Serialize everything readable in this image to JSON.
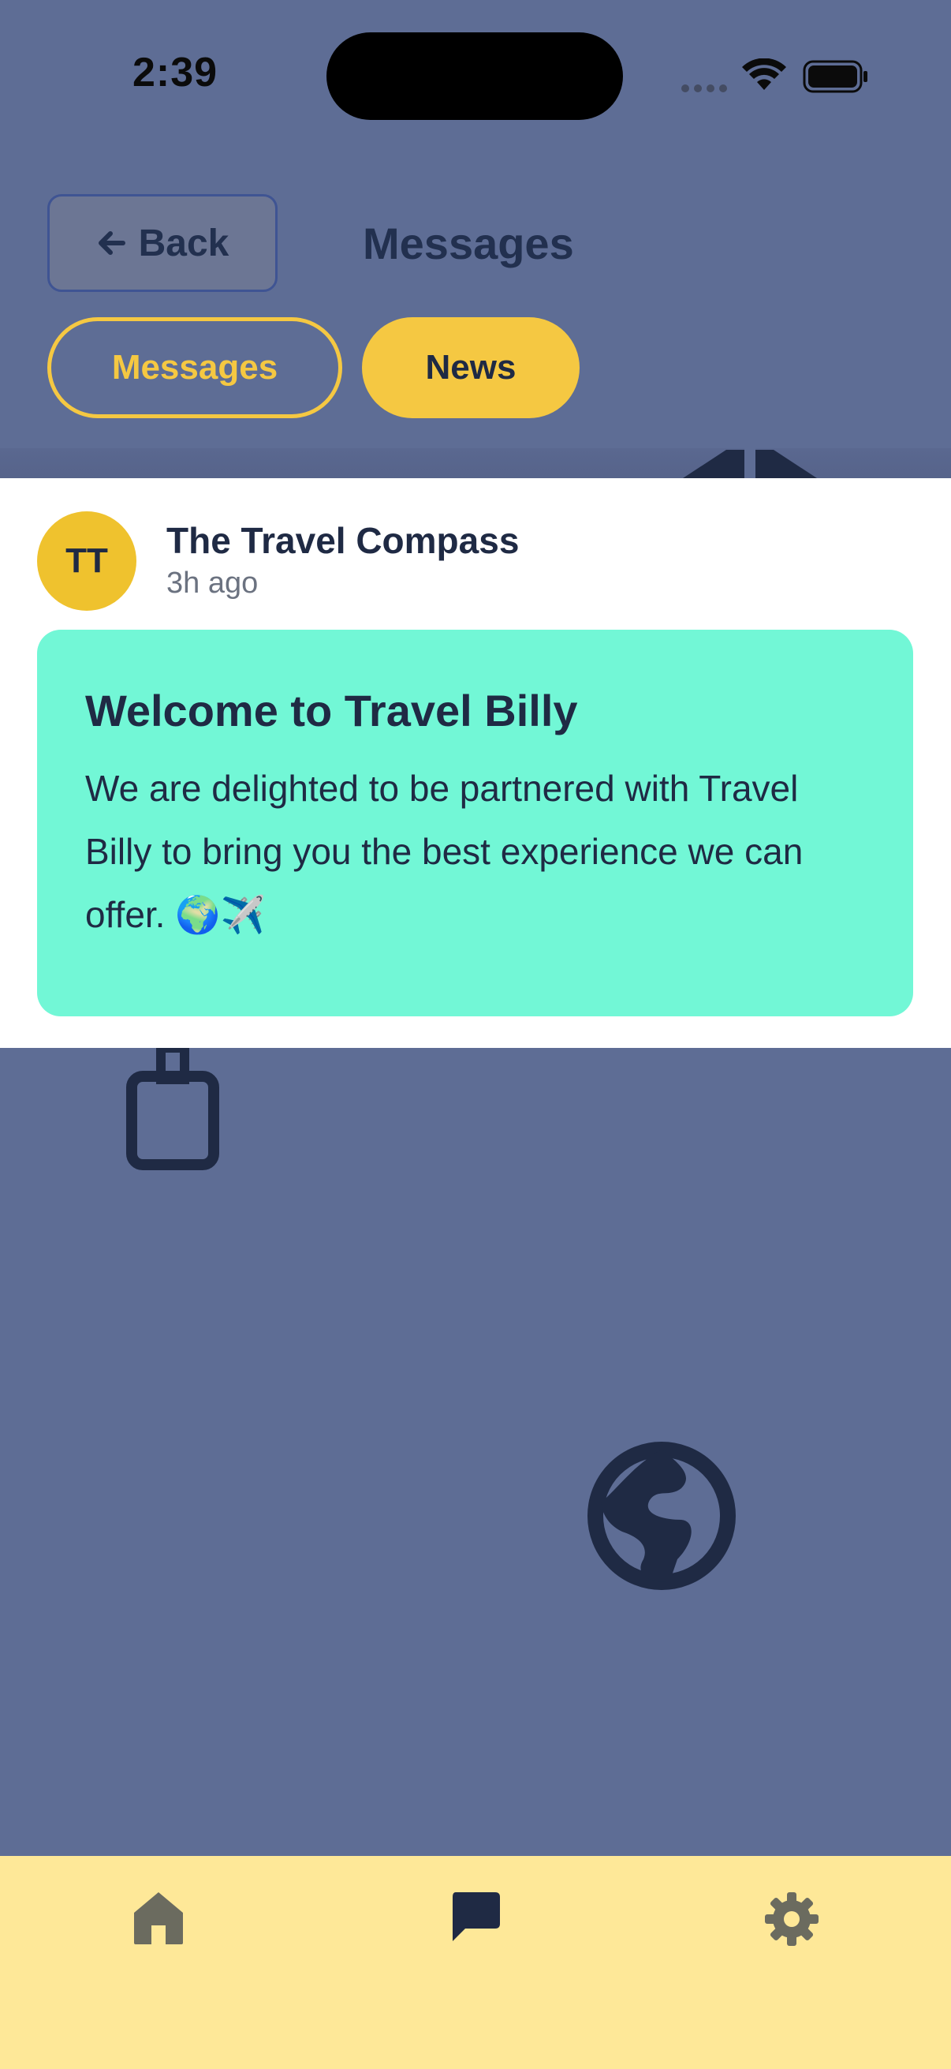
{
  "status_bar": {
    "time": "2:39",
    "wifi_icon": "wifi-icon",
    "battery_icon": "battery-icon"
  },
  "header": {
    "back_label": "Back",
    "back_icon": "arrow-left-icon",
    "title": "Messages"
  },
  "tabs": [
    {
      "label": "Messages",
      "selected": false
    },
    {
      "label": "News",
      "selected": true
    }
  ],
  "message": {
    "avatar_initials": "TT",
    "sender": "The Travel Compass",
    "time_ago": "3h ago",
    "title": "Welcome to Travel Billy",
    "body": "We are delighted to be partnered with Travel Billy to bring you the best experience we can offer. 🌍✈️"
  },
  "bottom_nav": {
    "items": [
      {
        "icon": "home-icon",
        "active": false
      },
      {
        "icon": "chat-icon",
        "active": true
      },
      {
        "icon": "settings-gear-icon",
        "active": false
      }
    ]
  },
  "colors": {
    "background": "#5e6d95",
    "accent": "#f5c842",
    "bubble": "#72f7d6",
    "nav": "#fee898",
    "text_dark": "#1f2a44"
  }
}
